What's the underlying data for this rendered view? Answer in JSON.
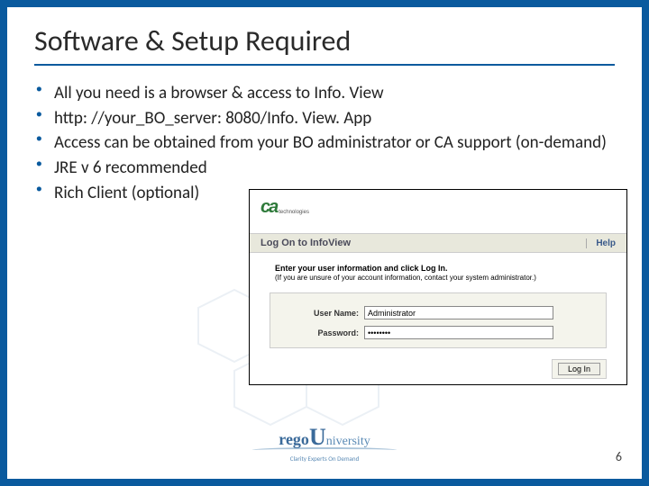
{
  "title": "Software & Setup Required",
  "bullets": [
    "All you need is a browser & access to Info. View",
    "http: //your_BO_server: 8080/Info. View. App",
    "Access can be obtained from your BO administrator or CA support (on-demand)",
    "JRE v 6 recommended",
    "Rich Client (optional)"
  ],
  "screenshot": {
    "logo_text": "ca",
    "logo_sub": "technologies",
    "bar_label": "Log On to InfoView",
    "help": "Help",
    "instr_bold": "Enter your user information and click Log In.",
    "instr_small": "(If you are unsure of your account information, contact your system administrator.)",
    "username_label": "User Name:",
    "username_value": "Administrator",
    "password_label": "Password:",
    "password_value": "••••••••",
    "login_button": "Log In"
  },
  "footer": {
    "logo_rego": "rego",
    "logo_u": "U",
    "logo_rest": "niversity",
    "tagline": "Clarity Experts On Demand"
  },
  "page_number": "6"
}
